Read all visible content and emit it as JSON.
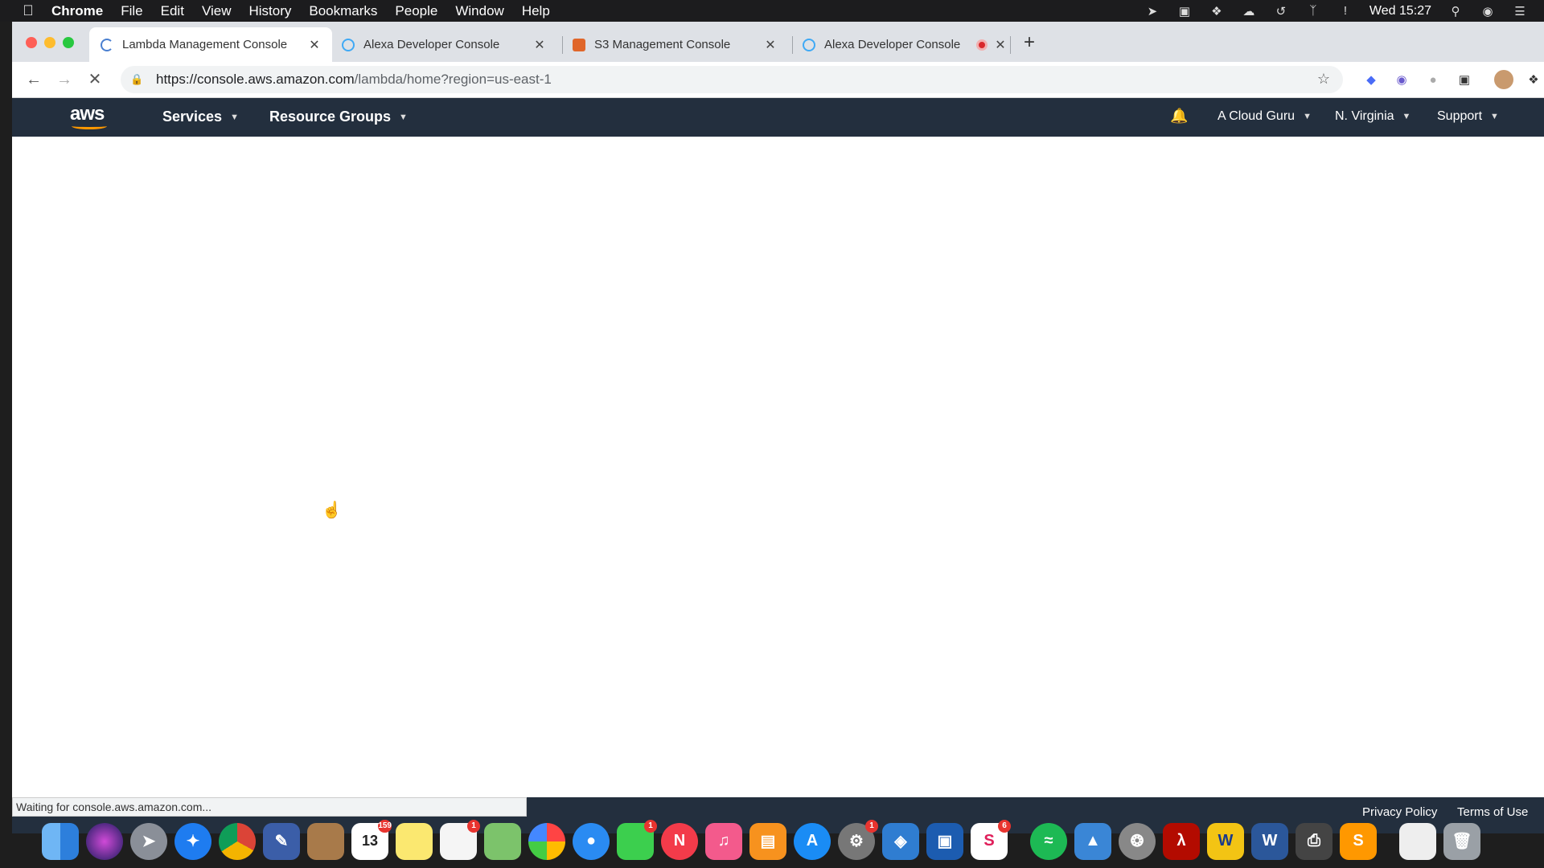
{
  "menubar": {
    "app_name": "Chrome",
    "menus": [
      "File",
      "Edit",
      "View",
      "History",
      "Bookmarks",
      "People",
      "Window",
      "Help"
    ],
    "clock": "Wed 15:27"
  },
  "tabs": [
    {
      "title": "Lambda Management Console",
      "active": true
    },
    {
      "title": "Alexa Developer Console",
      "active": false
    },
    {
      "title": "S3 Management Console",
      "active": false
    },
    {
      "title": "Alexa Developer Console",
      "active": false
    }
  ],
  "omnibox": {
    "url_host": "https://console.aws.amazon.com",
    "url_path": "/lambda/home?region=us-east-1"
  },
  "aws": {
    "logo_text": "aws",
    "services_label": "Services",
    "resource_groups_label": "Resource Groups",
    "account_label": "A Cloud Guru",
    "region_label": "N. Virginia",
    "support_label": "Support"
  },
  "footer": {
    "status_text": "Waiting for console.aws.amazon.com...",
    "privacy_label": "Privacy Policy",
    "terms_label": "Terms of Use"
  },
  "dock": {
    "calendar_day": "13",
    "badges": {
      "calendar": "159",
      "reminders": "1",
      "facetime": "1",
      "system_prefs": "1",
      "slack": "6"
    }
  },
  "colors": {
    "aws_nav": "#232f3e",
    "aws_orange": "#ff9900",
    "tab_strip": "#dee1e6"
  }
}
